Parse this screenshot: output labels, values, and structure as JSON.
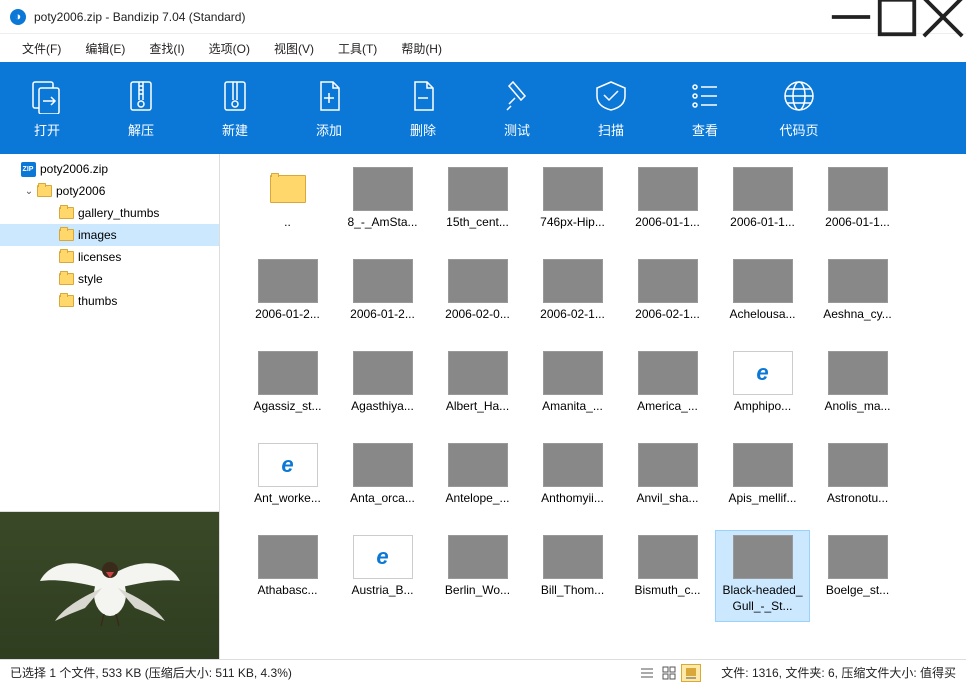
{
  "window": {
    "title": "poty2006.zip - Bandizip 7.04 (Standard)"
  },
  "menu": {
    "file": "文件(F)",
    "edit": "编辑(E)",
    "find": "查找(I)",
    "options": "选项(O)",
    "view": "视图(V)",
    "tools": "工具(T)",
    "help": "帮助(H)"
  },
  "toolbar": {
    "open": "打开",
    "extract": "解压",
    "new": "新建",
    "add": "添加",
    "delete": "删除",
    "test": "测试",
    "scan": "扫描",
    "view": "查看",
    "codepage": "代码页"
  },
  "tree": {
    "root": "poty2006.zip",
    "folder": "poty2006",
    "children": [
      "gallery_thumbs",
      "images",
      "licenses",
      "style",
      "thumbs"
    ],
    "selected": "images"
  },
  "files": [
    {
      "name": "..",
      "type": "folder"
    },
    {
      "name": "8_-_AmSta...",
      "type": "img",
      "cls": "t1"
    },
    {
      "name": "15th_cent...",
      "type": "img",
      "cls": "t2"
    },
    {
      "name": "746px-Hip...",
      "type": "img",
      "cls": "t3"
    },
    {
      "name": "2006-01-1...",
      "type": "img",
      "cls": "t4"
    },
    {
      "name": "2006-01-1...",
      "type": "img",
      "cls": "t5"
    },
    {
      "name": "2006-01-1...",
      "type": "img",
      "cls": "t9"
    },
    {
      "name": "2006-01-2...",
      "type": "img",
      "cls": "t6"
    },
    {
      "name": "2006-01-2...",
      "type": "img",
      "cls": "t8"
    },
    {
      "name": "2006-02-0...",
      "type": "img",
      "cls": "t11"
    },
    {
      "name": "2006-02-1...",
      "type": "img",
      "cls": "t8"
    },
    {
      "name": "2006-02-1...",
      "type": "img",
      "cls": "t7"
    },
    {
      "name": "Achelousa...",
      "type": "img",
      "cls": "t6"
    },
    {
      "name": "Aeshna_cy...",
      "type": "img",
      "cls": "t10"
    },
    {
      "name": "Agassiz_st...",
      "type": "img",
      "cls": "t17"
    },
    {
      "name": "Agasthiya...",
      "type": "img",
      "cls": "t7"
    },
    {
      "name": "Albert_Ha...",
      "type": "img",
      "cls": "t9"
    },
    {
      "name": "Amanita_...",
      "type": "img",
      "cls": "t15"
    },
    {
      "name": "America_...",
      "type": "img",
      "cls": "t14"
    },
    {
      "name": "Amphipo...",
      "type": "ie"
    },
    {
      "name": "Anolis_ma...",
      "type": "img",
      "cls": "t8"
    },
    {
      "name": "Ant_worke...",
      "type": "ie"
    },
    {
      "name": "Anta_orca...",
      "type": "img",
      "cls": "t11"
    },
    {
      "name": "Antelope_...",
      "type": "img",
      "cls": "t11"
    },
    {
      "name": "Anthomyii...",
      "type": "img",
      "cls": "t16"
    },
    {
      "name": "Anvil_sha...",
      "type": "img",
      "cls": "t7"
    },
    {
      "name": "Apis_mellif...",
      "type": "img",
      "cls": "t19"
    },
    {
      "name": "Astronotu...",
      "type": "img",
      "cls": "t17"
    },
    {
      "name": "Athabasc...",
      "type": "img",
      "cls": "t12"
    },
    {
      "name": "Austria_B...",
      "type": "ie"
    },
    {
      "name": "Berlin_Wo...",
      "type": "img",
      "cls": "t8"
    },
    {
      "name": "Bill_Thom...",
      "type": "img",
      "cls": "t18"
    },
    {
      "name": "Bismuth_c...",
      "type": "img",
      "cls": "t6"
    },
    {
      "name": "Black-headed_Gull_-_St...",
      "type": "img",
      "cls": "t5",
      "selected": true
    },
    {
      "name": "Boelge_st...",
      "type": "img",
      "cls": "t20"
    }
  ],
  "status": {
    "selection": "已选择 1 个文件, 533 KB (压缩后大小: 511 KB, 4.3%)",
    "summary": "文件: 1316, 文件夹: 6, 压缩文件大小: 值得买"
  }
}
